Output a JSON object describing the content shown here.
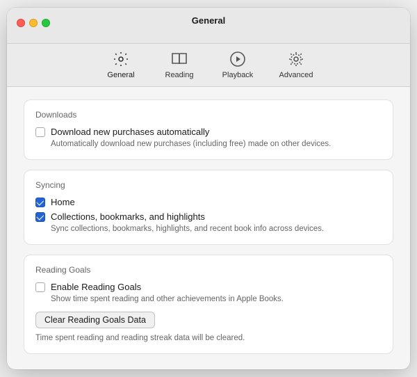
{
  "window": {
    "title": "General"
  },
  "toolbar": {
    "items": [
      {
        "id": "general",
        "label": "General",
        "active": true
      },
      {
        "id": "reading",
        "label": "Reading",
        "active": false
      },
      {
        "id": "playback",
        "label": "Playback",
        "active": false
      },
      {
        "id": "advanced",
        "label": "Advanced",
        "active": false
      }
    ]
  },
  "sections": {
    "downloads": {
      "label": "Downloads",
      "option": {
        "title": "Download new purchases automatically",
        "desc": "Automatically download new purchases (including free) made on other devices.",
        "checked": false
      }
    },
    "syncing": {
      "label": "Syncing",
      "options": [
        {
          "id": "home",
          "title": "Home",
          "checked": true
        },
        {
          "id": "collections",
          "title": "Collections, bookmarks, and highlights",
          "checked": true
        }
      ],
      "desc": "Sync collections, bookmarks, highlights, and recent book info across devices."
    },
    "reading_goals": {
      "label": "Reading Goals",
      "option": {
        "title": "Enable Reading Goals",
        "desc": "Show time spent reading and other achievements in Apple Books.",
        "checked": false
      },
      "clear_button": "Clear Reading Goals Data",
      "clear_desc": "Time spent reading and reading streak data will be cleared."
    }
  }
}
